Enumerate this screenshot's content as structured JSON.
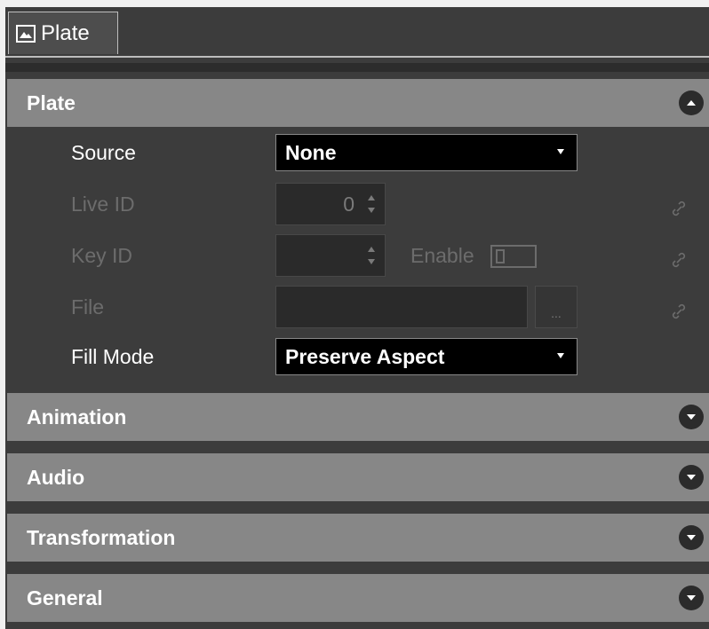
{
  "tab": {
    "label": "Plate",
    "icon": "image-icon"
  },
  "sections": {
    "plate": {
      "title": "Plate",
      "expanded": true
    },
    "animation": {
      "title": "Animation",
      "expanded": false
    },
    "audio": {
      "title": "Audio",
      "expanded": false
    },
    "transformation": {
      "title": "Transformation",
      "expanded": false
    },
    "general": {
      "title": "General",
      "expanded": false
    }
  },
  "plate_fields": {
    "source": {
      "label": "Source",
      "value": "None"
    },
    "live_id": {
      "label": "Live ID",
      "value": "0"
    },
    "key_id": {
      "label": "Key ID",
      "value": ""
    },
    "enable": {
      "label": "Enable",
      "checked": false
    },
    "file": {
      "label": "File",
      "value": "",
      "browse_label": "..."
    },
    "fill_mode": {
      "label": "Fill Mode",
      "value": "Preserve Aspect"
    }
  },
  "colors": {
    "panel_bg": "#3c3c3c",
    "section_header_bg": "#878787",
    "dropdown_bg": "#000000",
    "disabled_text": "#6c6c6c"
  }
}
